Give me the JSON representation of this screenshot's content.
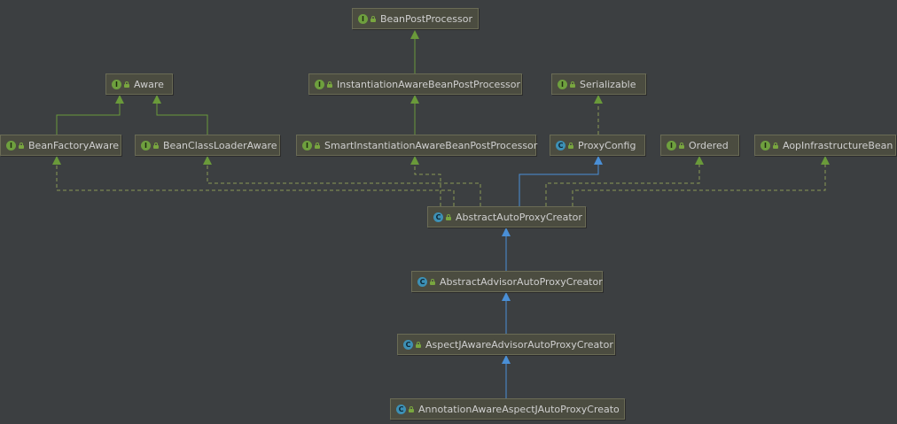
{
  "diagram": {
    "nodes": [
      {
        "id": "bpp",
        "kind": "interface",
        "kind_letter": "I",
        "label": "BeanPostProcessor"
      },
      {
        "id": "aware",
        "kind": "interface",
        "kind_letter": "I",
        "label": "Aware"
      },
      {
        "id": "iabpp",
        "kind": "interface",
        "kind_letter": "I",
        "label": "InstantiationAwareBeanPostProcessor"
      },
      {
        "id": "ser",
        "kind": "interface",
        "kind_letter": "I",
        "label": "Serializable"
      },
      {
        "id": "bfa",
        "kind": "interface",
        "kind_letter": "I",
        "label": "BeanFactoryAware"
      },
      {
        "id": "bcla",
        "kind": "interface",
        "kind_letter": "I",
        "label": "BeanClassLoaderAware"
      },
      {
        "id": "siabpp",
        "kind": "interface",
        "kind_letter": "I",
        "label": "SmartInstantiationAwareBeanPostProcessor"
      },
      {
        "id": "pc",
        "kind": "class",
        "kind_letter": "C",
        "label": "ProxyConfig"
      },
      {
        "id": "ord",
        "kind": "interface",
        "kind_letter": "I",
        "label": "Ordered"
      },
      {
        "id": "aib",
        "kind": "interface",
        "kind_letter": "I",
        "label": "AopInfrastructureBean"
      },
      {
        "id": "aapc",
        "kind": "class",
        "kind_letter": "C",
        "label": "AbstractAutoProxyCreator"
      },
      {
        "id": "aaapc",
        "kind": "class",
        "kind_letter": "C",
        "label": "AbstractAdvisorAutoProxyCreator"
      },
      {
        "id": "ajaapc",
        "kind": "class",
        "kind_letter": "C",
        "label": "AspectJAwareAdvisorAutoProxyCreator"
      },
      {
        "id": "anaapc",
        "kind": "class",
        "kind_letter": "C",
        "label": "AnnotationAwareAspectJAutoProxyCreato"
      }
    ],
    "edges": [
      {
        "from": "iabpp",
        "to": "bpp",
        "type": "extends"
      },
      {
        "from": "bfa",
        "to": "aware",
        "type": "extends"
      },
      {
        "from": "bcla",
        "to": "aware",
        "type": "extends"
      },
      {
        "from": "siabpp",
        "to": "iabpp",
        "type": "extends"
      },
      {
        "from": "pc",
        "to": "ser",
        "type": "implements"
      },
      {
        "from": "aapc",
        "to": "bfa",
        "type": "implements"
      },
      {
        "from": "aapc",
        "to": "bcla",
        "type": "implements"
      },
      {
        "from": "aapc",
        "to": "siabpp",
        "type": "implements"
      },
      {
        "from": "aapc",
        "to": "pc",
        "type": "extends-class"
      },
      {
        "from": "aapc",
        "to": "ord",
        "type": "implements"
      },
      {
        "from": "aapc",
        "to": "aib",
        "type": "implements"
      },
      {
        "from": "aaapc",
        "to": "aapc",
        "type": "extends-class"
      },
      {
        "from": "ajaapc",
        "to": "aaapc",
        "type": "extends-class"
      },
      {
        "from": "anaapc",
        "to": "ajaapc",
        "type": "extends-class"
      }
    ],
    "colors": {
      "background": "#3c3f41",
      "interface_edge": "#6a9a3a",
      "class_edge": "#4a8fd6",
      "implements_edge": "#8a9a55",
      "interface_badge": "#6ea03e",
      "class_badge": "#3d90b5"
    }
  }
}
